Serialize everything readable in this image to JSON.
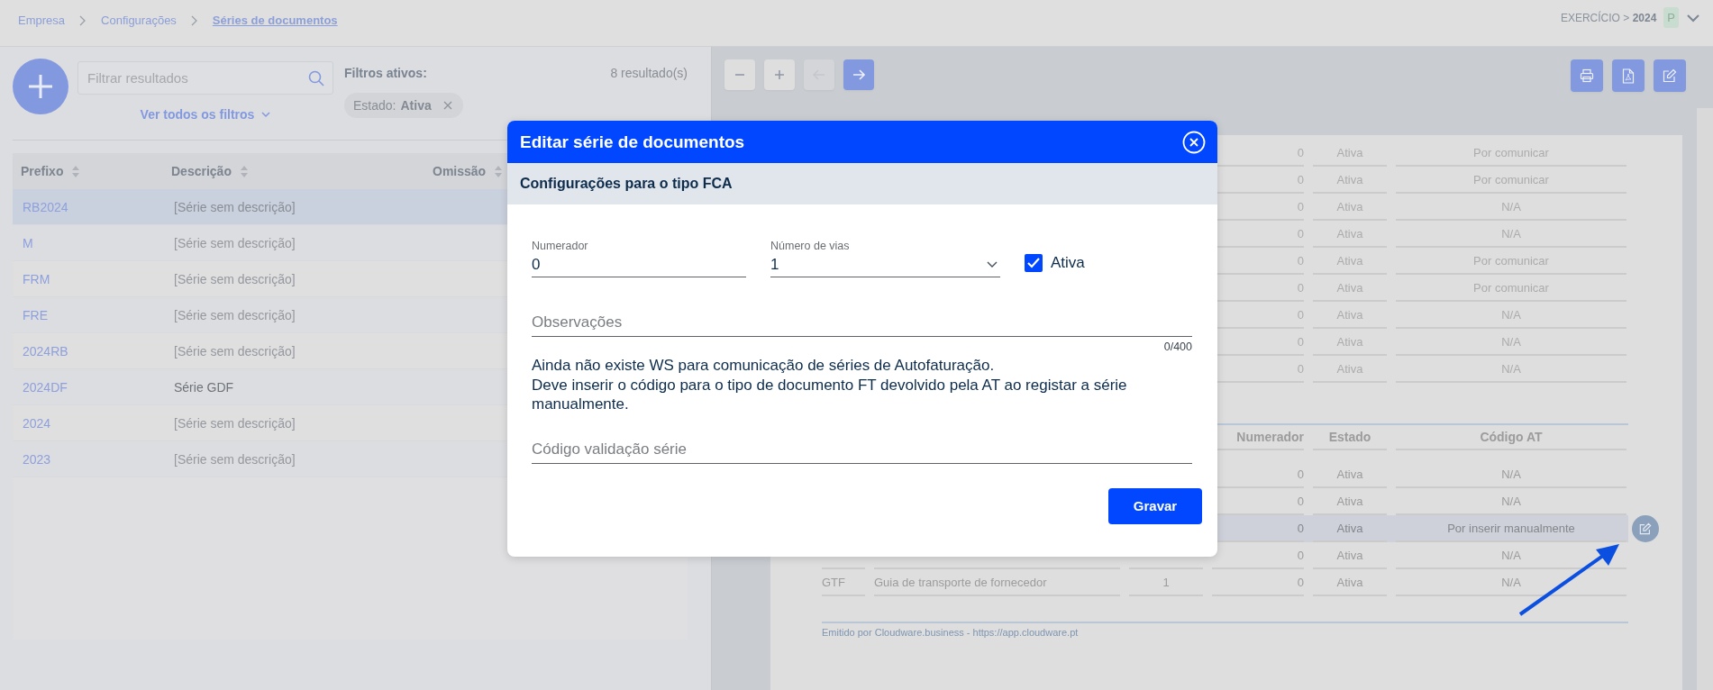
{
  "breadcrumbs": [
    {
      "label": "Empresa",
      "current": false
    },
    {
      "label": "Configurações",
      "current": false
    },
    {
      "label": "Séries de documentos",
      "current": true
    }
  ],
  "fiscal_year": {
    "label": "EXERCÍCIO >",
    "year": "2024"
  },
  "user_badge": "P",
  "list_panel": {
    "search": {
      "placeholder": "Filtrar resultados"
    },
    "filters_link": "Ver todos os filtros",
    "active_filters_label": "Filtros ativos:",
    "result_count": "8 resultado(s)",
    "filter_chips": [
      {
        "label": "Estado:",
        "value": "Ativa"
      }
    ],
    "table": {
      "columns": [
        "Prefixo",
        "Descrição",
        "Omissão"
      ],
      "rows": [
        {
          "prefix": "RB2024",
          "description": "[Série sem descrição]",
          "muted": true,
          "selected": true
        },
        {
          "prefix": "M",
          "description": "[Série sem descrição]",
          "muted": true,
          "selected": false
        },
        {
          "prefix": "FRM",
          "description": "[Série sem descrição]",
          "muted": true,
          "selected": false
        },
        {
          "prefix": "FRE",
          "description": "[Série sem descrição]",
          "muted": true,
          "selected": false
        },
        {
          "prefix": "2024RB",
          "description": "[Série sem descrição]",
          "muted": true,
          "selected": false
        },
        {
          "prefix": "2024DF",
          "description": "Série GDF",
          "muted": false,
          "selected": false
        },
        {
          "prefix": "2024",
          "description": "[Série sem descrição]",
          "muted": true,
          "selected": false
        },
        {
          "prefix": "2023",
          "description": "[Série sem descrição]",
          "muted": true,
          "selected": false
        }
      ]
    }
  },
  "toolbar": [
    {
      "kind": "minus",
      "primary": false,
      "disabled": false
    },
    {
      "kind": "plus",
      "primary": false,
      "disabled": false
    },
    {
      "kind": "arrow-left",
      "primary": false,
      "disabled": true
    },
    {
      "kind": "arrow-right",
      "primary": true,
      "disabled": false
    }
  ],
  "document_actions": [
    {
      "kind": "print"
    },
    {
      "kind": "pdf"
    },
    {
      "kind": "edit"
    }
  ],
  "document": {
    "upper_rows": [
      {
        "numerator": "0",
        "state": "Ativa",
        "at_code": "Por comunicar"
      },
      {
        "numerator": "0",
        "state": "Ativa",
        "at_code": "Por comunicar"
      },
      {
        "numerator": "0",
        "state": "Ativa",
        "at_code": "N/A"
      },
      {
        "numerator": "0",
        "state": "Ativa",
        "at_code": "N/A"
      },
      {
        "numerator": "0",
        "state": "Ativa",
        "at_code": "Por comunicar"
      },
      {
        "numerator": "0",
        "state": "Ativa",
        "at_code": "Por comunicar"
      },
      {
        "numerator": "0",
        "state": "Ativa",
        "at_code": "N/A"
      },
      {
        "numerator": "0",
        "state": "Ativa",
        "at_code": "N/A"
      },
      {
        "numerator": "0",
        "state": "Ativa",
        "at_code": "N/A"
      }
    ],
    "lower_table": {
      "columns": [
        "Numerador",
        "Estado",
        "Código AT"
      ],
      "rows": [
        {
          "numerator": "0",
          "state": "Ativa",
          "at_code": "N/A",
          "hovered": false
        },
        {
          "numerator": "0",
          "state": "Ativa",
          "at_code": "N/A",
          "hovered": false
        },
        {
          "numerator": "0",
          "state": "Ativa",
          "at_code": "Por inserir manualmente",
          "hovered": true
        },
        {
          "numerator": "0",
          "state": "Ativa",
          "at_code": "N/A",
          "hovered": false
        },
        {
          "prefix": "GTF",
          "description": "Guia de transporte de fornecedor",
          "copies": "1",
          "numerator": "0",
          "state": "Ativa",
          "at_code": "N/A",
          "hovered": false
        }
      ]
    },
    "footer": "Emitido por Cloudware.business - https://app.cloudware.pt"
  },
  "modal": {
    "title": "Editar série de documentos",
    "subtitle": "Configurações para o tipo FCA",
    "numerator": {
      "label": "Numerador",
      "value": "0"
    },
    "copies": {
      "label": "Número de vias",
      "value": "1"
    },
    "active": {
      "label": "Ativa",
      "checked": true
    },
    "notes": {
      "placeholder": "Observações",
      "counter": "0/400"
    },
    "message": [
      "Ainda não existe WS para comunicação de séries de Autofaturação.",
      "Deve inserir o código para o tipo de documento FT devolvido pela AT ao registar a série manualmente."
    ],
    "validation_code": {
      "placeholder": "Código validação série"
    },
    "save_button": "Gravar"
  }
}
